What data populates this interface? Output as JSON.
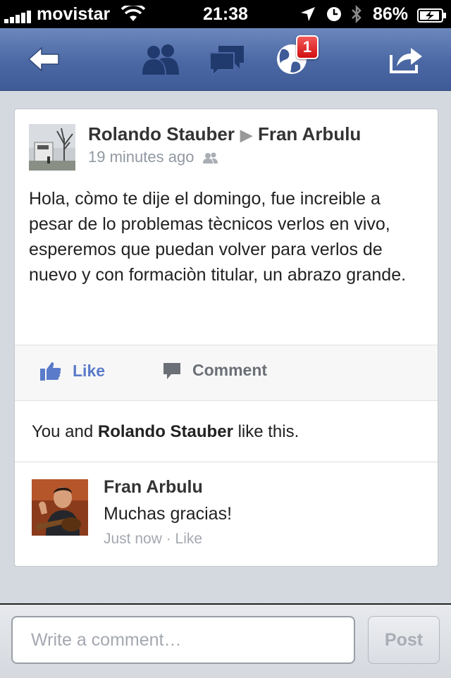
{
  "status_bar": {
    "carrier": "movistar",
    "time": "21:38",
    "battery": "86%"
  },
  "nav": {
    "notification_count": "1"
  },
  "post": {
    "author": "Rolando Stauber",
    "recipient": "Fran Arbulu",
    "arrow": "▶",
    "time": "19 minutes ago",
    "text": "Hola, còmo te dije el domingo, fue increible a pesar de lo problemas tècnicos verlos en vivo, esperemos que puedan volver para verlos de nuevo y con formaciòn titular, un abrazo grande.",
    "like_label": "Like",
    "comment_label": "Comment",
    "likes_prefix": "You and ",
    "likes_name": "Rolando Stauber",
    "likes_suffix": " like this."
  },
  "comment": {
    "author": "Fran Arbulu",
    "text": "Muchas gracias!",
    "time": "Just now",
    "separator": " · ",
    "like_label": "Like"
  },
  "composer": {
    "placeholder": "Write a comment…",
    "post_label": "Post"
  },
  "colors": {
    "nav_blue": "#4b68a4",
    "link_blue": "#5a7bc9",
    "badge_red": "#d10f0f"
  }
}
